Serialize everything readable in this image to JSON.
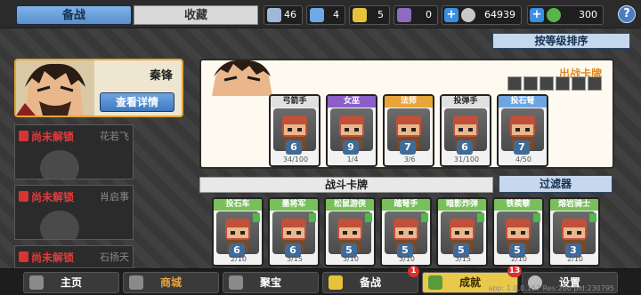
{
  "header": {
    "tab_active": "备战",
    "tab_inactive": "收藏",
    "resources": [
      {
        "icon": "blue-gem-icon",
        "value": "46",
        "color": "#9fb8d8"
      },
      {
        "icon": "blue-crystal-icon",
        "value": "4",
        "color": "#6ea8e6"
      },
      {
        "icon": "gold-crest-icon",
        "value": "5",
        "color": "#e6c23a"
      },
      {
        "icon": "purple-crest-icon",
        "value": "0",
        "color": "#8d6bc2"
      },
      {
        "icon": "silver-coin-icon",
        "value": "64939",
        "color": "#c8c8c8"
      },
      {
        "icon": "green-coin-icon",
        "value": "300",
        "color": "#58b54a"
      }
    ],
    "help": "?"
  },
  "sort_button": "按等级排序",
  "hero": {
    "name": "秦锋",
    "detail_button": "查看详情"
  },
  "locked_heroes": [
    {
      "status": "尚未解锁",
      "name": "花若飞"
    },
    {
      "status": "尚未解锁",
      "name": "肖启事"
    },
    {
      "status": "尚未解锁",
      "name": "石扬天"
    }
  ],
  "battle_deck": {
    "title": "出战卡牌",
    "cards": [
      {
        "name": "弓箭手",
        "cost": "6",
        "level": "34/100",
        "color": "#e0e0e0",
        "text": "#222"
      },
      {
        "name": "女巫",
        "cost": "9",
        "level": "1/4",
        "color": "#8b5ec9",
        "text": "#fff"
      },
      {
        "name": "法师",
        "cost": "7",
        "level": "3/6",
        "color": "#e7a53a",
        "text": "#fff"
      },
      {
        "name": "投弹手",
        "cost": "6",
        "level": "31/100",
        "color": "#e0e0e0",
        "text": "#222"
      },
      {
        "name": "投石弩",
        "cost": "7",
        "level": "4/50",
        "color": "#6da5e3",
        "text": "#fff"
      }
    ]
  },
  "combat_section": {
    "label": "战斗卡牌",
    "filter": "过滤器",
    "cards": [
      {
        "name": "投石车",
        "cost": "6",
        "level": "2/10",
        "color": "#77c05a"
      },
      {
        "name": "墨将军",
        "cost": "6",
        "level": "3/15",
        "color": "#77c05a"
      },
      {
        "name": "松鼠游侠",
        "cost": "5",
        "level": "3/10",
        "color": "#77c05a"
      },
      {
        "name": "踏弩手",
        "cost": "5",
        "level": "3/10",
        "color": "#77c05a"
      },
      {
        "name": "暗影炸弹墨...",
        "cost": "5",
        "level": "3/15",
        "color": "#77c05a"
      },
      {
        "name": "铁蒺藜",
        "cost": "5",
        "level": "2/10",
        "color": "#77c05a"
      },
      {
        "name": "熔岩骑士",
        "cost": "3",
        "level": "2/10",
        "color": "#77c05a"
      }
    ]
  },
  "bottom_nav": [
    {
      "label": "主页",
      "icon": "home-icon",
      "active": false
    },
    {
      "label": "商城",
      "icon": "shop-icon",
      "active": false
    },
    {
      "label": "聚宝",
      "icon": "treasure-icon",
      "active": false
    },
    {
      "label": "备战",
      "icon": "deck-icon",
      "active": false,
      "badge": "1"
    },
    {
      "label": "成就",
      "icon": "trophy-icon",
      "active": true,
      "badge": "13"
    },
    {
      "label": "设置",
      "icon": "gear-icon",
      "active": false
    }
  ],
  "version": "app: 1.0.0.157 Res:200 pid:230795"
}
